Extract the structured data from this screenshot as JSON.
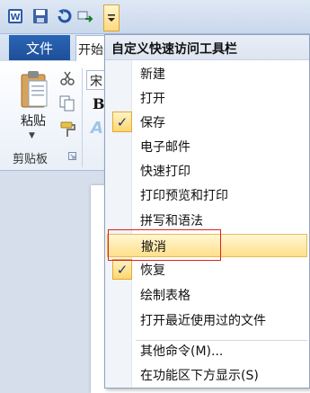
{
  "qat": {
    "icons": [
      "word-icon",
      "save-icon",
      "undo-icon",
      "redo-icon",
      "chevron-down-icon"
    ]
  },
  "ribbon": {
    "tabs": {
      "file": "文件",
      "home": "开始"
    },
    "clipboard": {
      "paste": "粘贴",
      "group_label": "剪贴板"
    },
    "font": {
      "name_visible": "宋",
      "bold": "B",
      "effects": "A"
    }
  },
  "menu": {
    "title": "自定义快速访问工具栏",
    "items": [
      {
        "label": "新建",
        "checked": false
      },
      {
        "label": "打开",
        "checked": false
      },
      {
        "label": "保存",
        "checked": true
      },
      {
        "label": "电子邮件",
        "checked": false
      },
      {
        "label": "快速打印",
        "checked": false
      },
      {
        "label": "打印预览和打印",
        "checked": false
      },
      {
        "label": "拼写和语法",
        "checked": false
      },
      {
        "label": "撤消",
        "checked": false,
        "hovered": true
      },
      {
        "label": "恢复",
        "checked": true
      },
      {
        "label": "绘制表格",
        "checked": false
      },
      {
        "label": "打开最近使用过的文件",
        "checked": false
      }
    ],
    "more_commands": "其他命令(M)...",
    "show_below": "在功能区下方显示(S)",
    "check_glyph": "✓"
  },
  "colors": {
    "hover_fill": "#ffe08b",
    "check_fill": "#ffd66d",
    "annotation_box": "#e02020",
    "file_tab": "#2a65b6"
  }
}
